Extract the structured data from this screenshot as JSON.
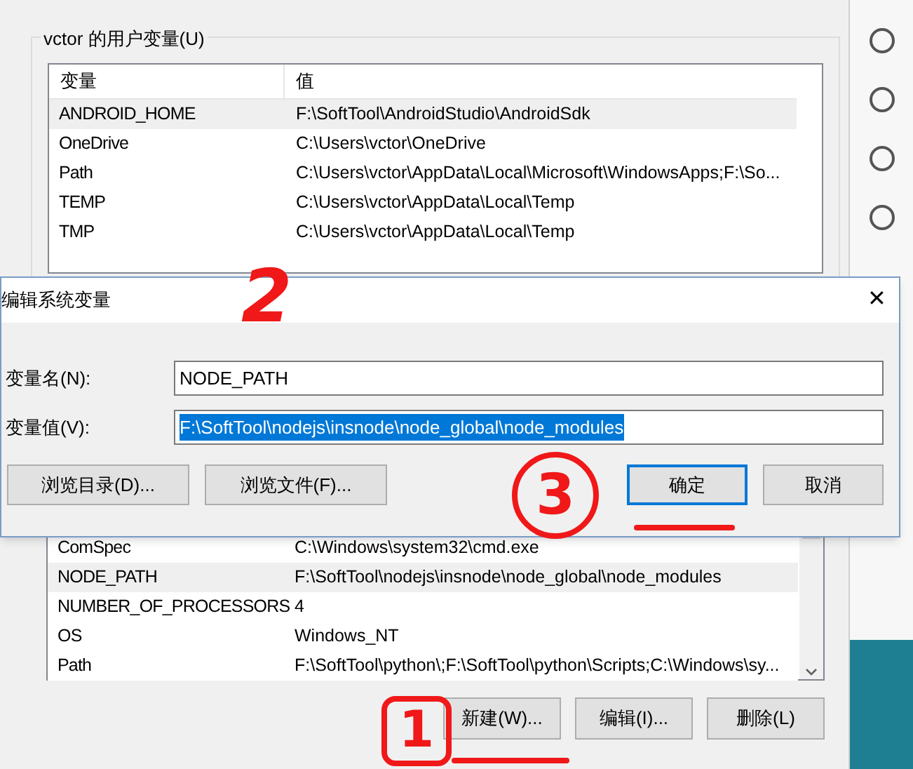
{
  "user_vars": {
    "title": "vctor 的用户变量(U)",
    "columns": [
      "变量",
      "值"
    ],
    "rows": [
      {
        "name": "ANDROID_HOME",
        "value": "F:\\SoftTool\\AndroidStudio\\AndroidSdk",
        "selected": true
      },
      {
        "name": "OneDrive",
        "value": "C:\\Users\\vctor\\OneDrive",
        "selected": false
      },
      {
        "name": "Path",
        "value": "C:\\Users\\vctor\\AppData\\Local\\Microsoft\\WindowsApps;F:\\So...",
        "selected": false
      },
      {
        "name": "TEMP",
        "value": "C:\\Users\\vctor\\AppData\\Local\\Temp",
        "selected": false
      },
      {
        "name": "TMP",
        "value": "C:\\Users\\vctor\\AppData\\Local\\Temp",
        "selected": false
      }
    ]
  },
  "system_vars": {
    "rows": [
      {
        "name": "ComSpec",
        "value": "C:\\Windows\\system32\\cmd.exe",
        "selected": false
      },
      {
        "name": "NODE_PATH",
        "value": "F:\\SoftTool\\nodejs\\insnode\\node_global\\node_modules",
        "selected": true
      },
      {
        "name": "NUMBER_OF_PROCESSORS",
        "value": "4",
        "selected": false
      },
      {
        "name": "OS",
        "value": "Windows_NT",
        "selected": false
      },
      {
        "name": "Path",
        "value": "F:\\SoftTool\\python\\;F:\\SoftTool\\python\\Scripts;C:\\Windows\\sy...",
        "selected": false
      }
    ],
    "buttons": [
      "新建(W)...",
      "编辑(I)...",
      "删除(L)"
    ]
  },
  "dialog": {
    "title": "编辑系统变量",
    "close": "✕",
    "fields": [
      {
        "label": "变量名(N):",
        "value": "NODE_PATH",
        "selected": false
      },
      {
        "label": "变量值(V):",
        "value": "F:\\SoftTool\\nodejs\\insnode\\node_global\\node_modules",
        "selected": true
      }
    ],
    "buttons": [
      {
        "label": "浏览目录(D)...",
        "default": false
      },
      {
        "label": "浏览文件(F)...",
        "default": false
      },
      {
        "label": "确定",
        "default": true
      },
      {
        "label": "取消",
        "default": false
      }
    ]
  },
  "annotations": [
    {
      "text": "2"
    },
    {
      "text": "3"
    },
    {
      "text": "1"
    }
  ]
}
